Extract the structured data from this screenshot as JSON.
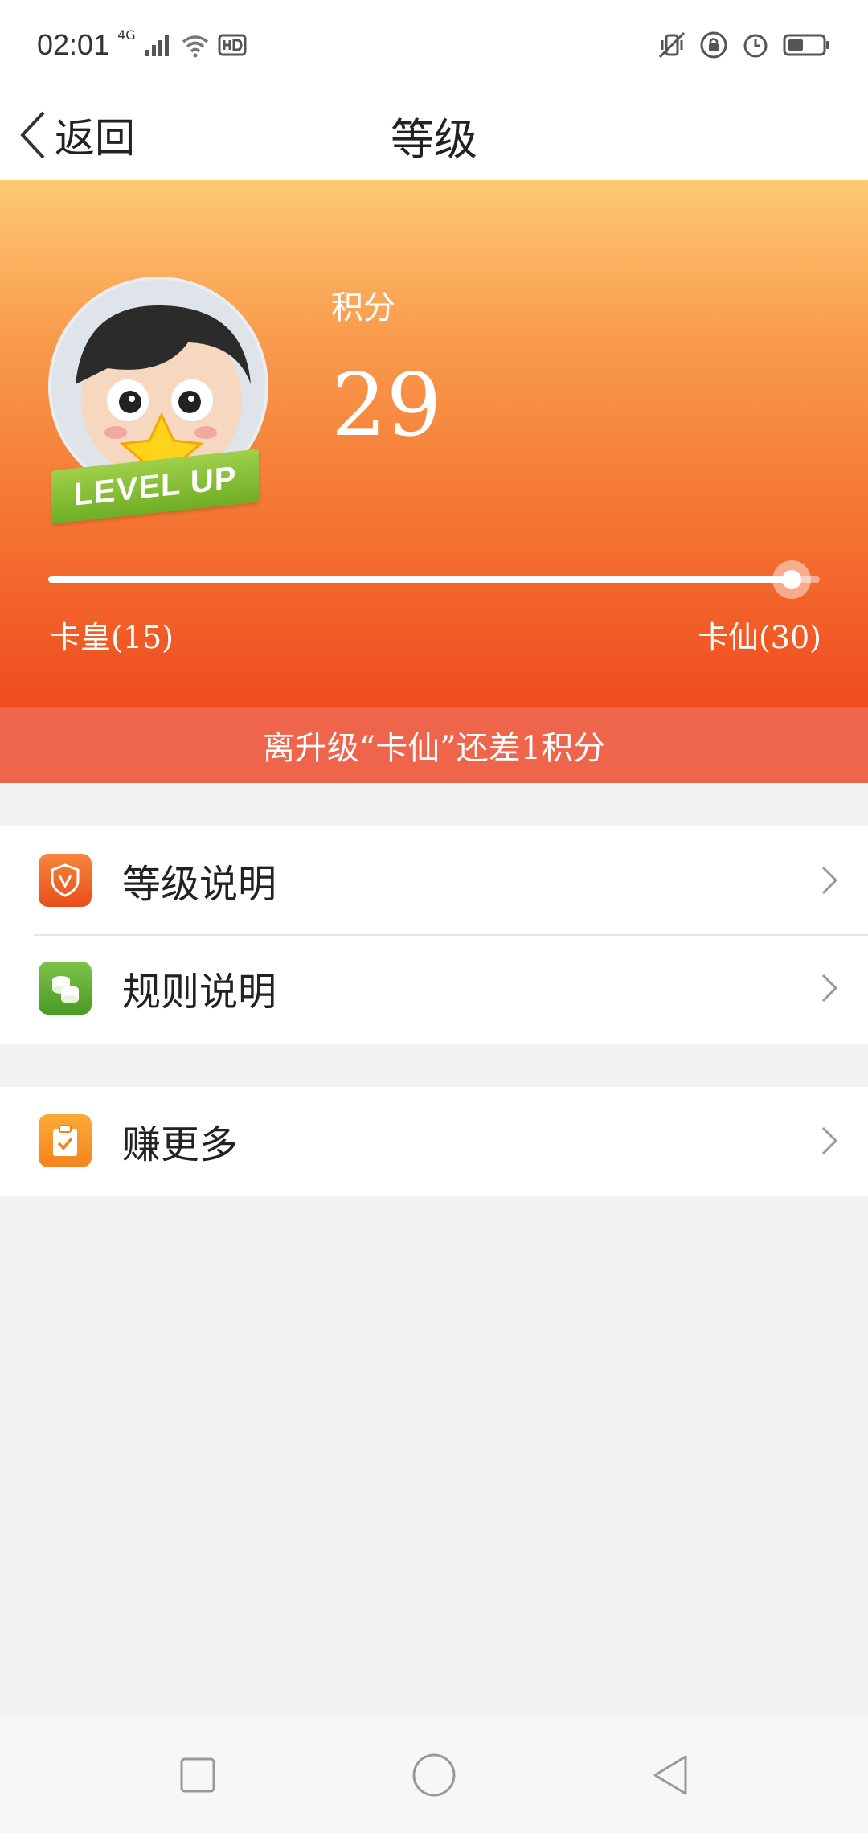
{
  "status_bar": {
    "time": "02:01",
    "network": "4G",
    "icons": [
      "signal-icon",
      "wifi-icon",
      "hd-icon",
      "vibrate-icon",
      "rotation-lock-icon",
      "alarm-icon",
      "battery-icon"
    ]
  },
  "nav": {
    "back_label": "返回",
    "title": "等级"
  },
  "hero": {
    "badge_text": "LEVEL UP",
    "points_label": "积分",
    "points_value": "29",
    "progress_fraction": 0.964,
    "level_current": "卡皇(15)",
    "level_next": "卡仙(30)",
    "gap_message": "离升级“卡仙”还差1积分",
    "colors": {
      "gradient_top": "#fdc972",
      "gradient_bottom": "#ef4b1f",
      "banner": "#ef654c"
    }
  },
  "menu": {
    "group1": [
      {
        "label": "等级说明",
        "icon": "shield-v-icon",
        "icon_color": "#f05a24"
      },
      {
        "label": "规则说明",
        "icon": "coins-icon",
        "icon_color": "#5aa932"
      }
    ],
    "group2": [
      {
        "label": "赚更多",
        "icon": "clipboard-check-icon",
        "icon_color": "#f7921e"
      }
    ]
  },
  "system_nav": {
    "buttons": [
      "recents-button",
      "home-button",
      "back-button"
    ]
  }
}
